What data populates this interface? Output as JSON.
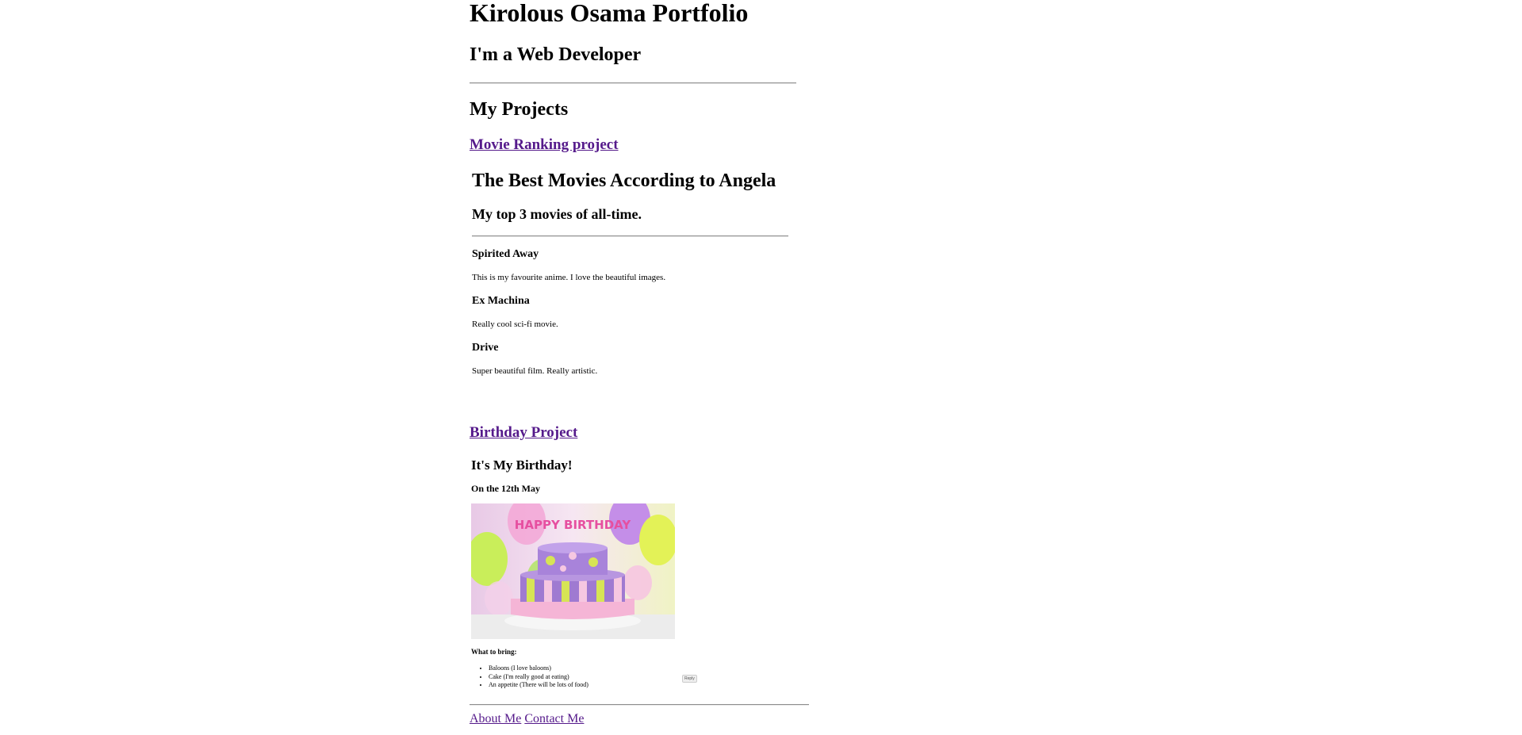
{
  "header": {
    "title": "Kirolous Osama Portfolio",
    "subtitle": "I'm a Web Developer"
  },
  "projects": {
    "heading": "My Projects",
    "movie": {
      "link": "Movie Ranking project",
      "title": "The Best Movies According to Angela",
      "subtitle": "My top 3 movies of all-time.",
      "items": [
        {
          "name": "Spirited Away",
          "desc": "This is my favourite anime. I love the beautiful images."
        },
        {
          "name": "Ex Machina",
          "desc": "Really cool sci-fi movie."
        },
        {
          "name": "Drive",
          "desc": "Super beautiful film. Really artistic."
        }
      ]
    },
    "birthday": {
      "link": "Birthday Project",
      "title": "It's My Birthday!",
      "date": "On the 12th May",
      "image_text": "HAPPY BIRTHDAY",
      "bring_label": "What to bring:",
      "bring": [
        "Baloons (I love baloons)",
        "Cake (I'm really good at eating)",
        "An appetite (There will be lots of food)"
      ],
      "mini_button": "Reply"
    }
  },
  "footer": {
    "about": "About Me",
    "contact": "Contact Me"
  },
  "colors": {
    "visited_link": "#551a8b",
    "rule": "#8e8e8e"
  }
}
